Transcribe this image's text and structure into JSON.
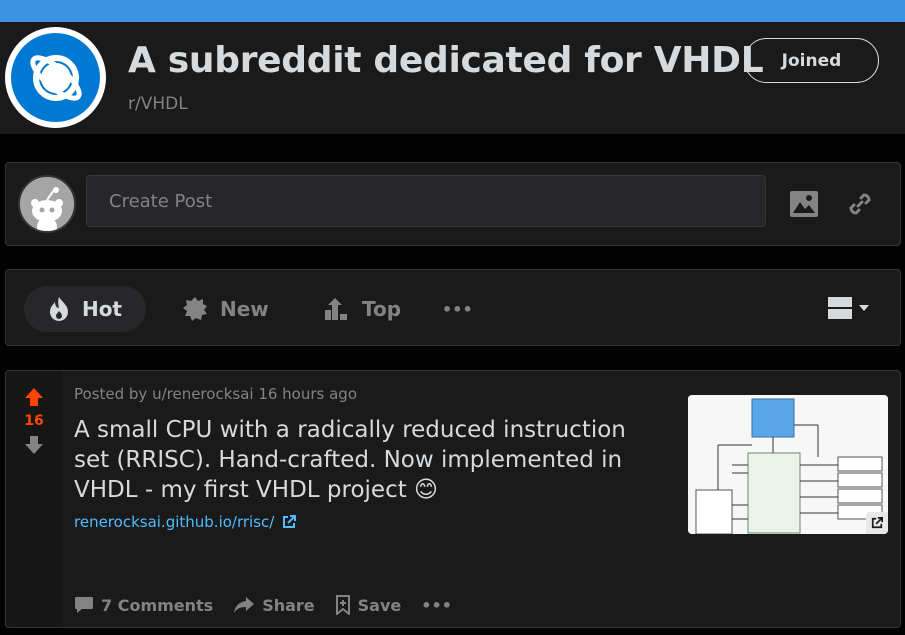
{
  "header": {
    "title": "A subreddit dedicated for VHDL",
    "subreddit": "r/VHDL",
    "join_label": "Joined",
    "icon": "planet-icon"
  },
  "create_post": {
    "placeholder": "Create Post",
    "image_icon": "image-icon",
    "link_icon": "link-icon"
  },
  "sort": {
    "items": [
      {
        "label": "Hot",
        "icon": "flame-icon",
        "active": true
      },
      {
        "label": "New",
        "icon": "burst-icon",
        "active": false
      },
      {
        "label": "Top",
        "icon": "top-icon",
        "active": false
      }
    ],
    "more_label": "•••"
  },
  "post": {
    "score": "16",
    "meta": "Posted by u/renerocksai 16 hours ago",
    "title": "A small CPU with a radically reduced instruction set (RRISC). Hand-crafted. Now implemented in VHDL - my first VHDL project 😊",
    "link": "renerocksai.github.io/rrisc/",
    "actions": {
      "comments": "7 Comments",
      "share": "Share",
      "save": "Save",
      "more": "•••"
    }
  },
  "colors": {
    "accent_blue": "#3a94e3",
    "upvote": "#ff4500",
    "link": "#4fbcff",
    "card_bg": "#1a1a1b"
  }
}
